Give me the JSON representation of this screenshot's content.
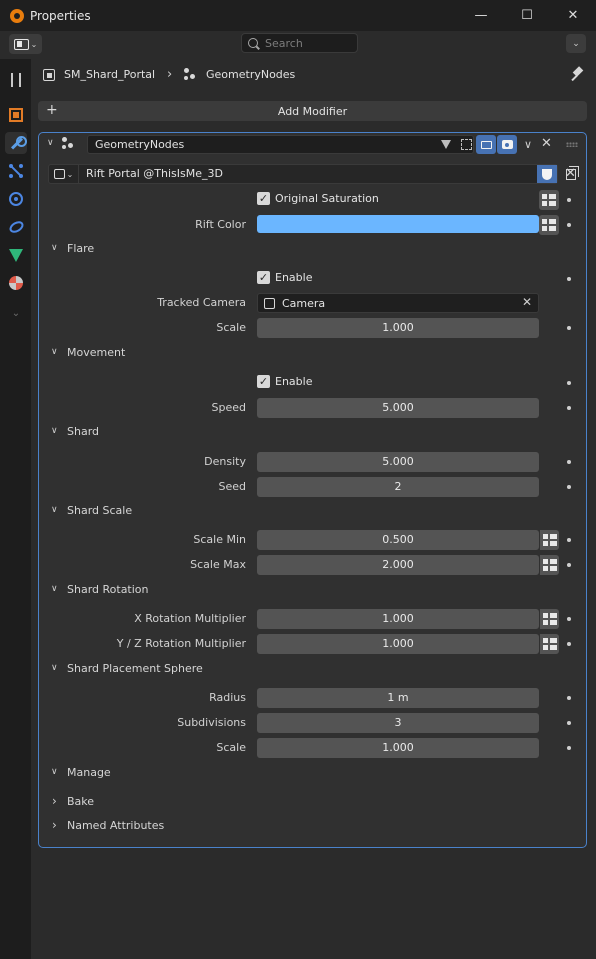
{
  "window": {
    "title": "Properties",
    "minimize_label": "—",
    "maximize_label": "☐",
    "close_label": "✕"
  },
  "header": {
    "search_placeholder": "Search"
  },
  "tabs": [
    {
      "name": "tool",
      "active": false
    },
    {
      "name": "object",
      "active": false
    },
    {
      "name": "modifiers",
      "active": true
    },
    {
      "name": "particles",
      "active": false
    },
    {
      "name": "physics",
      "active": false
    },
    {
      "name": "constraints",
      "active": false
    },
    {
      "name": "data",
      "active": false
    },
    {
      "name": "material",
      "active": false
    }
  ],
  "breadcrumb": {
    "object": "SM_Shard_Portal",
    "modifier": "GeometryNodes"
  },
  "add_modifier_label": "Add Modifier",
  "modifier": {
    "name": "GeometryNodes",
    "node_group": "Rift Portal @ThisIsMe_3D",
    "original_saturation": {
      "label": "Original Saturation",
      "checked": true
    },
    "rift_color": {
      "label": "Rift Color",
      "value": "#6bb6ff"
    }
  },
  "flare": {
    "title": "Flare",
    "enable_label": "Enable",
    "tracked_camera_label": "Tracked Camera",
    "tracked_camera_value": "Camera",
    "scale_label": "Scale",
    "scale_value": "1.000"
  },
  "movement": {
    "title": "Movement",
    "enable_label": "Enable",
    "speed_label": "Speed",
    "speed_value": "5.000"
  },
  "shard": {
    "title": "Shard",
    "density_label": "Density",
    "density_value": "5.000",
    "seed_label": "Seed",
    "seed_value": "2"
  },
  "shard_scale": {
    "title": "Shard Scale",
    "min_label": "Scale Min",
    "min_value": "0.500",
    "max_label": "Scale Max",
    "max_value": "2.000"
  },
  "shard_rotation": {
    "title": "Shard Rotation",
    "x_label": "X Rotation Multiplier",
    "x_value": "1.000",
    "yz_label": "Y / Z Rotation Multiplier",
    "yz_value": "1.000"
  },
  "placement": {
    "title": "Shard Placement Sphere",
    "radius_label": "Radius",
    "radius_value": "1 m",
    "subdiv_label": "Subdivisions",
    "subdiv_value": "3",
    "scale_label": "Scale",
    "scale_value": "1.000"
  },
  "manage": {
    "title": "Manage",
    "bake_label": "Bake",
    "named_attributes_label": "Named Attributes"
  },
  "colors": {
    "accent": "#4772b3",
    "panel_outline": "#4a82cb",
    "field": "#545454"
  }
}
